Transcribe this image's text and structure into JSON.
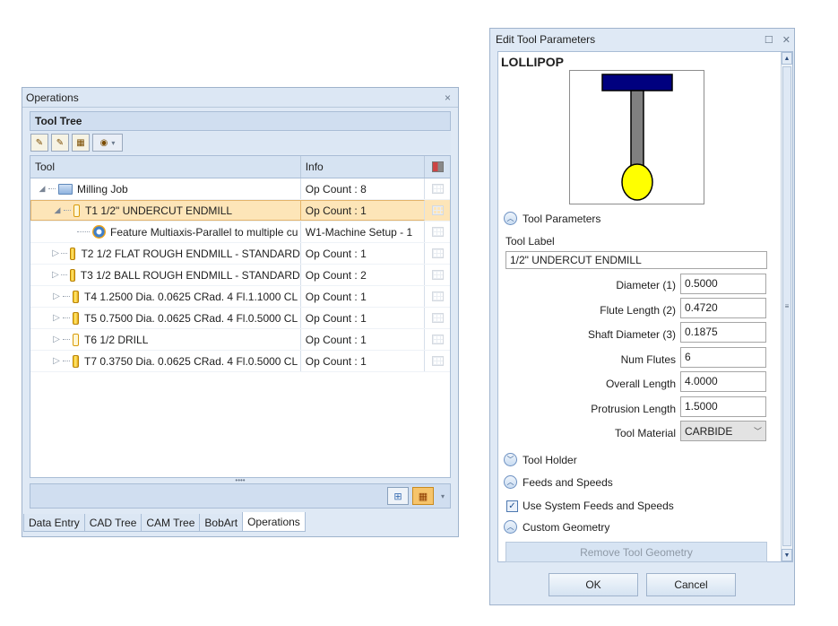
{
  "operations_panel": {
    "title": "Operations",
    "close_glyph": "×",
    "header": "Tool Tree",
    "columns": {
      "tool": "Tool",
      "info": "Info"
    },
    "rows": [
      {
        "label": "Milling Job",
        "info": "Op Count : 8",
        "icon": "folder-icon"
      },
      {
        "label": "T1 1/2\" UNDERCUT ENDMILL",
        "info": "Op Count : 1",
        "icon": "endmill-icon"
      },
      {
        "label": "Feature Multiaxis-Parallel to multiple cu",
        "info": "W1-Machine Setup - 1",
        "icon": "feature-gear-icon"
      },
      {
        "label": "T2 1/2 FLAT ROUGH ENDMILL - STANDARD",
        "info": "Op Count : 1",
        "icon": "endmill-icon"
      },
      {
        "label": "T3 1/2 BALL ROUGH ENDMILL - STANDARD",
        "info": "Op Count : 2",
        "icon": "endmill-icon"
      },
      {
        "label": "T4 1.2500 Dia. 0.0625 CRad. 4 Fl.1.1000 CL",
        "info": "Op Count : 1",
        "icon": "endmill-icon"
      },
      {
        "label": "T5 0.7500 Dia. 0.0625 CRad. 4 Fl.0.5000 CL",
        "info": "Op Count : 1",
        "icon": "endmill-icon"
      },
      {
        "label": "T6 1/2 DRILL",
        "info": "Op Count : 1",
        "icon": "drill-icon"
      },
      {
        "label": "T7 0.3750 Dia. 0.0625 CRad. 4 Fl.0.5000 CL",
        "info": "Op Count : 1",
        "icon": "endmill-icon"
      }
    ],
    "tabs": [
      "Data Entry",
      "CAD Tree",
      "CAM Tree",
      "BobArt",
      "Operations"
    ],
    "active_tab": "Operations"
  },
  "dialog": {
    "title": "Edit Tool Parameters",
    "tool_type": "LOLLIPOP",
    "sections": {
      "tool_parameters": "Tool Parameters",
      "tool_holder": "Tool Holder",
      "feeds_speeds": "Feeds and Speeds",
      "custom_geometry": "Custom Geometry"
    },
    "tool_label_caption": "Tool Label",
    "tool_label_value": "1/2\" UNDERCUT ENDMILL",
    "params": [
      {
        "label": "Diameter (1)",
        "value": "0.5000"
      },
      {
        "label": "Flute Length (2)",
        "value": "0.4720"
      },
      {
        "label": "Shaft Diameter (3)",
        "value": "0.1875"
      },
      {
        "label": "Num Flutes",
        "value": "6"
      },
      {
        "label": "Overall Length",
        "value": "4.0000"
      },
      {
        "label": "Protrusion Length",
        "value": "1.5000"
      }
    ],
    "tool_material_label": "Tool Material",
    "tool_material_value": "CARBIDE",
    "use_system_feeds": "Use System Feeds and Speeds",
    "use_system_feeds_checked": true,
    "remove_button": "Remove Tool Geometry",
    "ok": "OK",
    "cancel": "Cancel"
  },
  "colors": {
    "selection": "#fde5b8",
    "panel_bg": "#dfe9f5",
    "lollipop_head": "#ffff00",
    "lollipop_holder": "#00007f",
    "lollipop_shaft": "#808080"
  }
}
